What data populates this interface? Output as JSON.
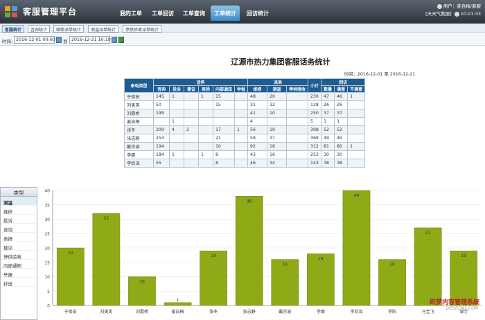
{
  "app": {
    "title": "客服管理平台"
  },
  "nav": [
    {
      "label": "我的工单"
    },
    {
      "label": "工单回访"
    },
    {
      "label": "工单查询"
    },
    {
      "label": "工单统计"
    },
    {
      "label": "回访统计"
    }
  ],
  "user": {
    "name": "用户：姜自梅/客服",
    "weather": "[天天气数据]",
    "time": "10:21:33"
  },
  "subtabs": [
    {
      "label": "客服统计"
    },
    {
      "label": "咨询统计"
    },
    {
      "label": "维修派单统计"
    },
    {
      "label": "测温派单统计"
    },
    {
      "label": "停供验收派单统计"
    }
  ],
  "filter": {
    "time_label": "时间:",
    "start": "2016-12-01 00:00",
    "to_label": "到",
    "end": "2016-12-21 10:19"
  },
  "report": {
    "title": "辽源市热力集团客服话务统计",
    "time": "时间：2016-12-01  至  2016-12-21",
    "col_type": "来电类型",
    "group_calls": "话务",
    "group_dispatch": "派单",
    "col_subtotal": "小计",
    "group_visit": "回访",
    "columns": [
      "咨询",
      "投诉",
      "建议",
      "表扬",
      "内部通知",
      "举报",
      "维修",
      "测温",
      "停供验收",
      "数量",
      "满意",
      "不满意"
    ],
    "rows": [
      {
        "name": "于俊宏",
        "cells": [
          "145",
          "1",
          "",
          "1",
          "15",
          "",
          "48",
          "20",
          "",
          "230",
          "47",
          "46",
          "1"
        ]
      },
      {
        "name": "刘美英",
        "cells": [
          "50",
          "",
          "",
          "",
          "15",
          "",
          "31",
          "32",
          "",
          "128",
          "26",
          "26",
          ""
        ]
      },
      {
        "name": "刘霞桥",
        "cells": [
          "199",
          "",
          "",
          "",
          "",
          "",
          "41",
          "10",
          "",
          "250",
          "37",
          "37",
          ""
        ]
      },
      {
        "name": "姜自梅",
        "cells": [
          "",
          "1",
          "",
          "",
          "",
          "",
          "4",
          "",
          "",
          "5",
          "1",
          "1",
          ""
        ]
      },
      {
        "name": "张冬",
        "cells": [
          "209",
          "4",
          "2",
          "",
          "17",
          "1",
          "56",
          "19",
          "",
          "308",
          "52",
          "52",
          ""
        ]
      },
      {
        "name": "张志野",
        "cells": [
          "253",
          "",
          "",
          "",
          "21",
          "",
          "58",
          "37",
          "",
          "369",
          "49",
          "49",
          ""
        ]
      },
      {
        "name": "戴宗渝",
        "cells": [
          "194",
          "",
          "",
          "",
          "10",
          "",
          "92",
          "16",
          "",
          "312",
          "81",
          "80",
          "1"
        ]
      },
      {
        "name": "李娜",
        "cells": [
          "184",
          "1",
          "",
          "1",
          "8",
          "",
          "43",
          "16",
          "",
          "253",
          "30",
          "30",
          ""
        ]
      },
      {
        "name": "李欣泽",
        "cells": [
          "55",
          "",
          "",
          "",
          "8",
          "",
          "46",
          "34",
          "",
          "143",
          "38",
          "38",
          ""
        ]
      }
    ]
  },
  "side": {
    "header": "类型",
    "items": [
      {
        "label": "测温",
        "active": true
      },
      {
        "label": "维修"
      },
      {
        "label": "投诉"
      },
      {
        "label": "咨询"
      },
      {
        "label": "表扬"
      },
      {
        "label": "建议"
      },
      {
        "label": "停供验收"
      },
      {
        "label": "内部通知"
      },
      {
        "label": "举报"
      },
      {
        "label": "抄送"
      }
    ]
  },
  "chart_data": {
    "type": "bar",
    "categories": [
      "于俊宏",
      "刘美英",
      "刘霞桥",
      "姜自梅",
      "张冬",
      "张志野",
      "戴宗渝",
      "李娜",
      "李欣泽",
      "李阳",
      "马宝飞",
      "邹宇"
    ],
    "values": [
      20,
      32,
      10,
      1,
      19,
      38,
      16,
      18,
      40,
      16,
      27,
      19
    ],
    "ylim": [
      0,
      40
    ],
    "yticks": [
      0,
      5,
      10,
      15,
      20,
      25,
      30,
      35,
      40
    ],
    "bar_color": "#8faa17",
    "grid": true
  },
  "watermark": {
    "line1": "织梦内容管理系统",
    "line2": "DEDECMS.COM"
  }
}
